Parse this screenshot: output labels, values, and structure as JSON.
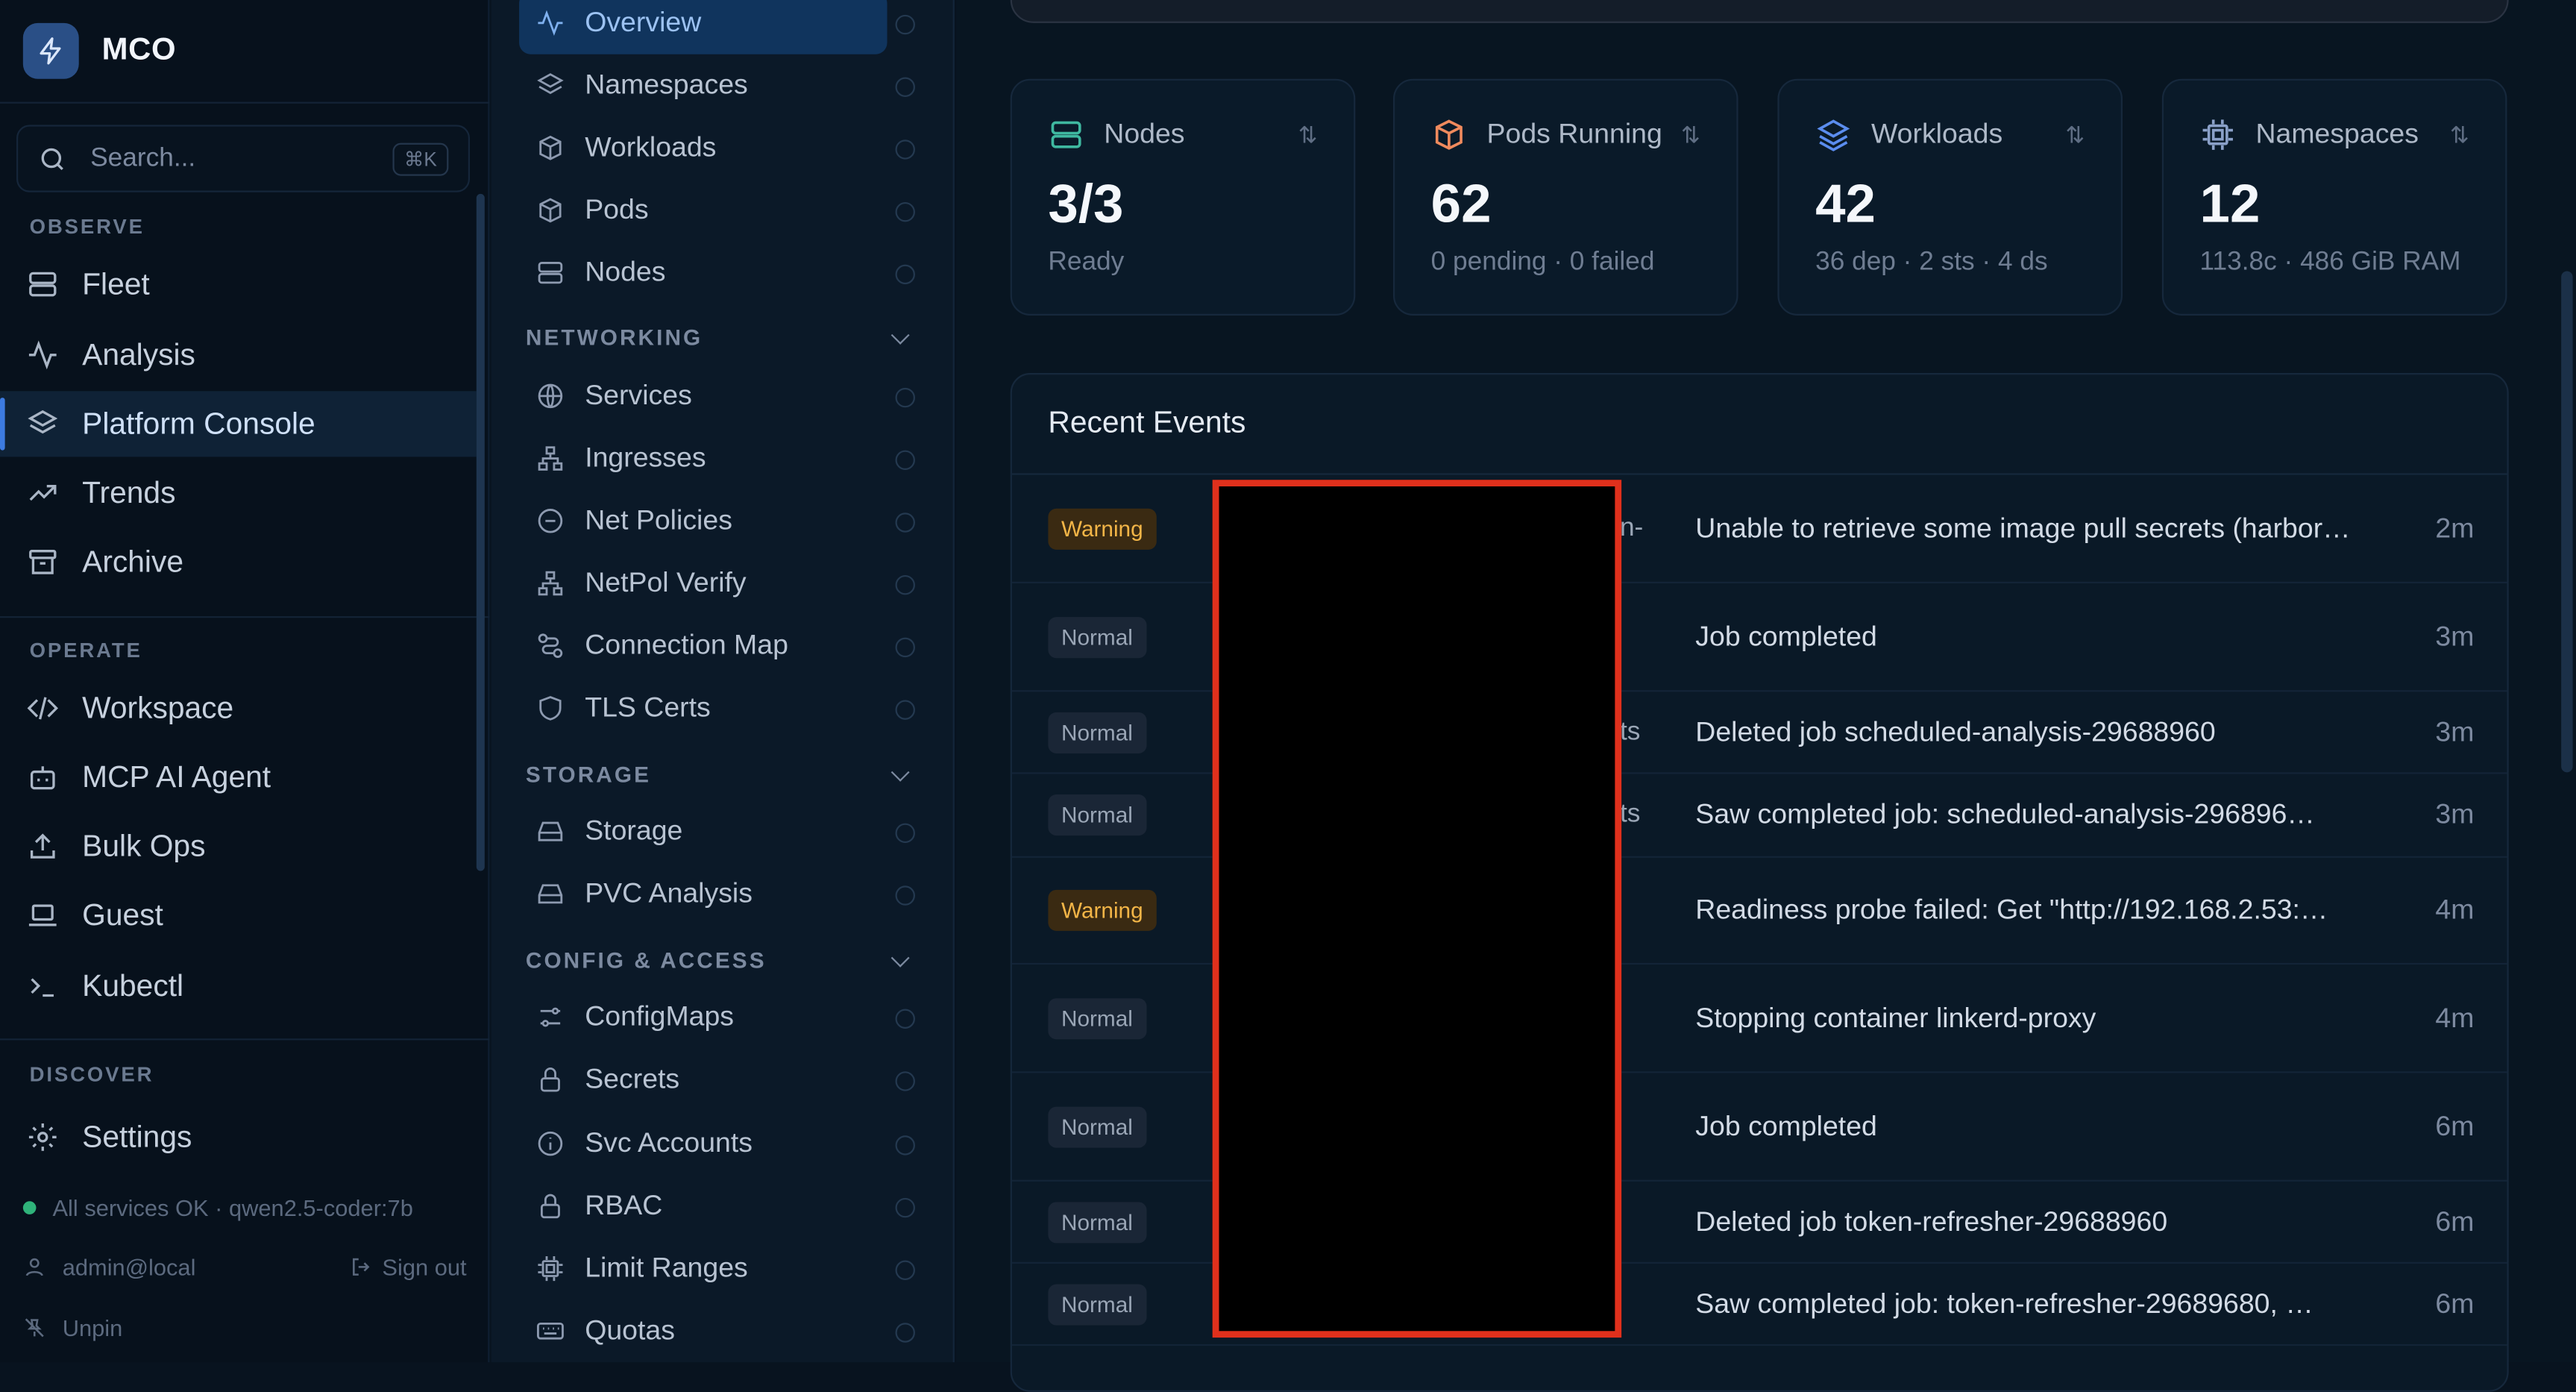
{
  "brand": {
    "name": "MCO"
  },
  "search": {
    "placeholder": "Search...",
    "shortcut": "⌘K"
  },
  "sidebar": {
    "sections": [
      {
        "title": "OBSERVE",
        "items": [
          {
            "label": "Fleet",
            "icon": "server-icon"
          },
          {
            "label": "Analysis",
            "icon": "activity-icon"
          },
          {
            "label": "Platform Console",
            "icon": "layers-icon",
            "active": true
          },
          {
            "label": "Trends",
            "icon": "trending-up-icon"
          },
          {
            "label": "Archive",
            "icon": "archive-icon"
          }
        ]
      },
      {
        "title": "OPERATE",
        "items": [
          {
            "label": "Workspace",
            "icon": "code-icon"
          },
          {
            "label": "MCP AI Agent",
            "icon": "bot-icon"
          },
          {
            "label": "Bulk Ops",
            "icon": "upload-icon"
          },
          {
            "label": "Guest",
            "icon": "laptop-icon"
          },
          {
            "label": "Kubectl",
            "icon": "terminal-icon"
          }
        ]
      },
      {
        "title": "DISCOVER",
        "items": [
          {
            "label": "Settings",
            "icon": "gear-icon"
          }
        ]
      }
    ],
    "footer": {
      "status": "All services OK · qwen2.5-coder:7b",
      "user": "admin@local",
      "signout": "Sign out",
      "unpin": "Unpin"
    }
  },
  "subnav": {
    "top_items": [
      {
        "label": "Overview",
        "active": true
      },
      {
        "label": "Namespaces"
      },
      {
        "label": "Workloads"
      },
      {
        "label": "Pods"
      },
      {
        "label": "Nodes"
      }
    ],
    "networking": {
      "title": "NETWORKING",
      "items": [
        "Services",
        "Ingresses",
        "Net Policies",
        "NetPol Verify",
        "Connection Map",
        "TLS Certs"
      ]
    },
    "storage": {
      "title": "STORAGE",
      "items": [
        "Storage",
        "PVC Analysis"
      ]
    },
    "config": {
      "title": "CONFIG & ACCESS",
      "items": [
        "ConfigMaps",
        "Secrets",
        "Svc Accounts",
        "RBAC",
        "Limit Ranges",
        "Quotas"
      ]
    }
  },
  "stats": [
    {
      "label": "Nodes",
      "value": "3/3",
      "sub": "Ready",
      "color": "#3fb8a0"
    },
    {
      "label": "Pods Running",
      "value": "62",
      "sub": "0 pending · 0 failed",
      "color": "#f08a5d"
    },
    {
      "label": "Workloads",
      "value": "42",
      "sub": "36 dep · 2 sts · 4 ds",
      "color": "#5b8def"
    },
    {
      "label": "Namespaces",
      "value": "12",
      "sub": "113.8c · 486 GiB RAM",
      "color": "#8aa0c8"
    }
  ],
  "events": {
    "title": "Recent Events",
    "rows": [
      {
        "type": "Warning",
        "obj": "n-",
        "message": "Unable to retrieve some image pull secrets (harbor…",
        "age": "2m"
      },
      {
        "type": "Normal",
        "obj": "",
        "message": "Job completed",
        "age": "3m"
      },
      {
        "type": "Normal",
        "obj": "ts",
        "message": "Deleted job scheduled-analysis-29688960",
        "age": "3m"
      },
      {
        "type": "Normal",
        "obj": "ts",
        "message": "Saw completed job: scheduled-analysis-296896…",
        "age": "3m"
      },
      {
        "type": "Warning",
        "obj": "",
        "message": "Readiness probe failed: Get \"http://192.168.2.53:…",
        "age": "4m"
      },
      {
        "type": "Normal",
        "obj": "",
        "message": "Stopping container linkerd-proxy",
        "age": "4m"
      },
      {
        "type": "Normal",
        "obj": "",
        "message": "Job completed",
        "age": "6m"
      },
      {
        "type": "Normal",
        "obj": "",
        "message": "Deleted job token-refresher-29688960",
        "age": "6m"
      },
      {
        "type": "Normal",
        "obj": "",
        "message": "Saw completed job: token-refresher-29689680, …",
        "age": "6m"
      }
    ]
  }
}
